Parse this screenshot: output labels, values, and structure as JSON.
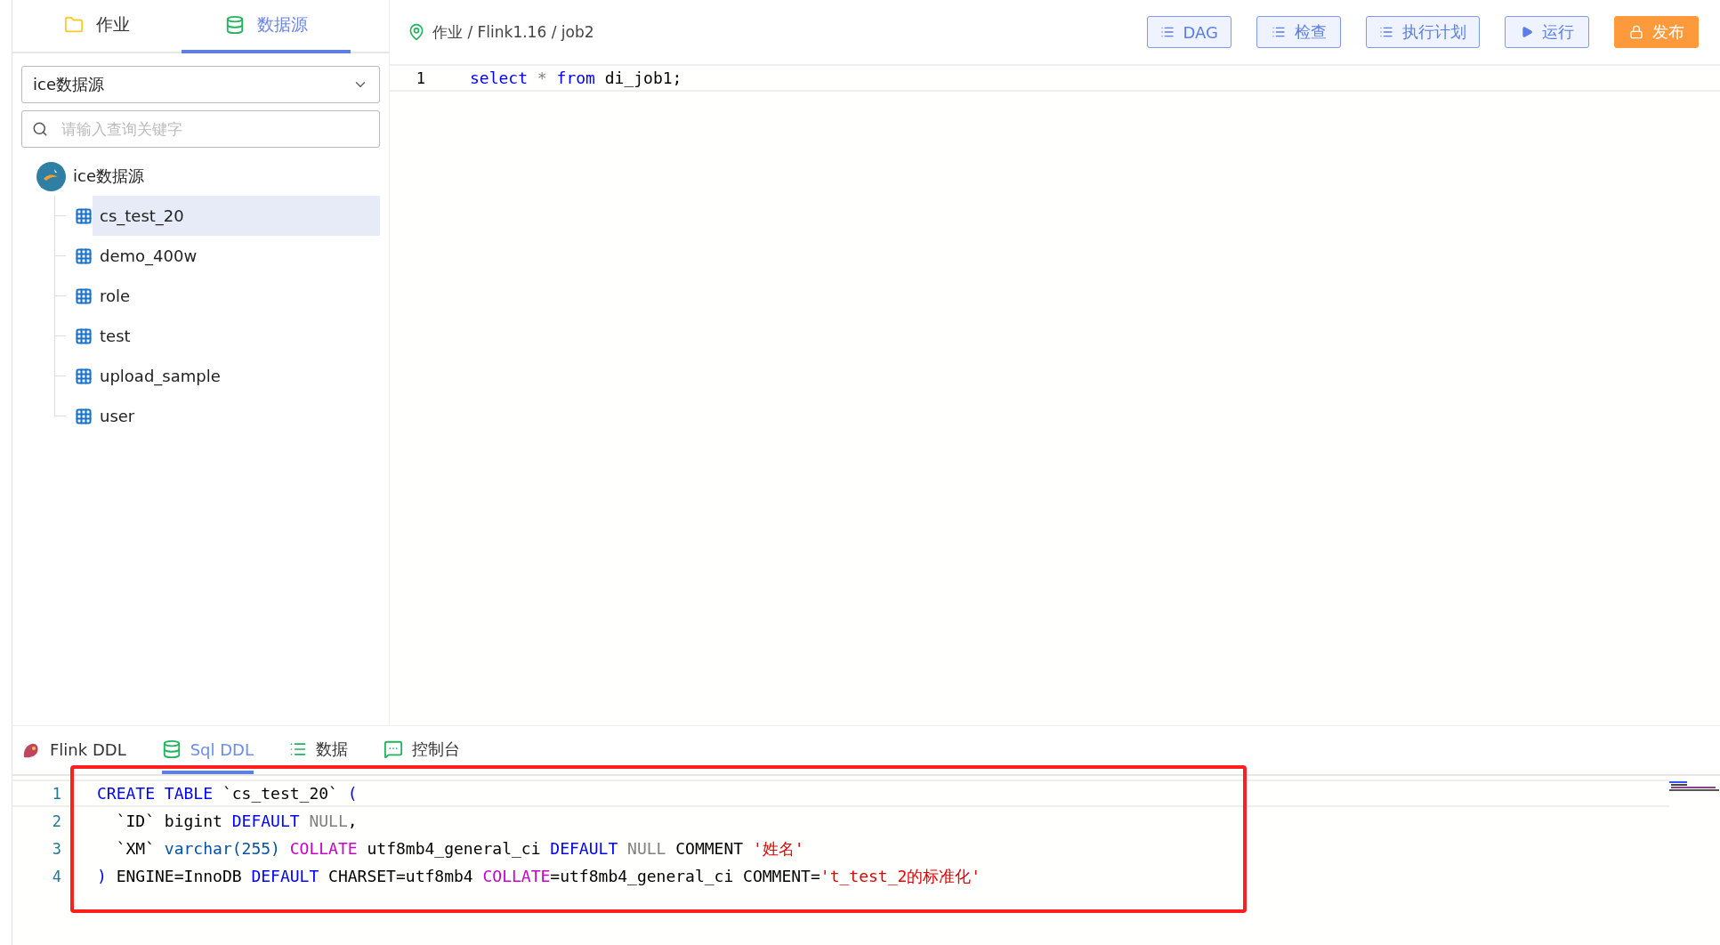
{
  "sidebar": {
    "tabs": [
      {
        "label": "作业",
        "selected": false
      },
      {
        "label": "数据源",
        "selected": true
      }
    ],
    "datasource_select": {
      "value": "ice数据源"
    },
    "search": {
      "placeholder": "请输入查询关键字"
    },
    "tree": {
      "label": "ice数据源",
      "expanded": true,
      "children": [
        {
          "label": "cs_test_20",
          "selected": true
        },
        {
          "label": "demo_400w",
          "selected": false
        },
        {
          "label": "role",
          "selected": false
        },
        {
          "label": "test",
          "selected": false
        },
        {
          "label": "upload_sample",
          "selected": false
        },
        {
          "label": "user",
          "selected": false
        }
      ]
    }
  },
  "breadcrumb": "作业 / Flink1.16 / job2",
  "toolbar": {
    "buttons": [
      {
        "label": "DAG",
        "kind": "outline"
      },
      {
        "label": "检查",
        "kind": "outline"
      },
      {
        "label": "执行计划",
        "kind": "outline"
      },
      {
        "label": "运行",
        "kind": "outline"
      },
      {
        "label": "发布",
        "kind": "primary"
      }
    ]
  },
  "editor": {
    "lines": [
      {
        "number": "1",
        "tokens": [
          {
            "kind": "keyword",
            "text": "select "
          },
          {
            "kind": "null",
            "text": "* "
          },
          {
            "kind": "keyword",
            "text": "from "
          },
          {
            "kind": "plain",
            "text": "di_job1;"
          }
        ]
      }
    ]
  },
  "bottom_panel": {
    "tabs": [
      {
        "label": "Flink DDL",
        "selected": false
      },
      {
        "label": "Sql DDL",
        "selected": true
      },
      {
        "label": "数据",
        "selected": false
      },
      {
        "label": "控制台",
        "selected": false
      }
    ],
    "code": {
      "lines": [
        {
          "number": "1",
          "tokens": [
            {
              "kind": "keyword",
              "text": "CREATE TABLE "
            },
            {
              "kind": "plain",
              "text": "`cs_test_20` "
            },
            {
              "kind": "keyword",
              "text": "("
            }
          ]
        },
        {
          "number": "2",
          "tokens": [
            {
              "kind": "plain",
              "text": "  `ID` bigint "
            },
            {
              "kind": "keyword",
              "text": "DEFAULT "
            },
            {
              "kind": "null",
              "text": "NULL"
            },
            {
              "kind": "plain",
              "text": ","
            }
          ]
        },
        {
          "number": "3",
          "tokens": [
            {
              "kind": "plain",
              "text": "  `XM` "
            },
            {
              "kind": "type",
              "text": "varchar(255) "
            },
            {
              "kind": "collate",
              "text": "COLLATE "
            },
            {
              "kind": "plain",
              "text": "utf8mb4_general_ci "
            },
            {
              "kind": "keyword",
              "text": "DEFAULT "
            },
            {
              "kind": "null",
              "text": "NULL "
            },
            {
              "kind": "plain",
              "text": "COMMENT "
            },
            {
              "kind": "string",
              "text": "'姓名'"
            }
          ]
        },
        {
          "number": "4",
          "tokens": [
            {
              "kind": "keyword",
              "text": ")"
            },
            {
              "kind": "plain",
              "text": " ENGINE=InnoDB "
            },
            {
              "kind": "keyword",
              "text": "DEFAULT"
            },
            {
              "kind": "plain",
              "text": " CHARSET=utf8mb4 "
            },
            {
              "kind": "collate",
              "text": "COLLATE"
            },
            {
              "kind": "plain",
              "text": "=utf8mb4_general_ci COMMENT="
            },
            {
              "kind": "string",
              "text": "'t_test_2的标准化'"
            }
          ]
        }
      ]
    }
  }
}
